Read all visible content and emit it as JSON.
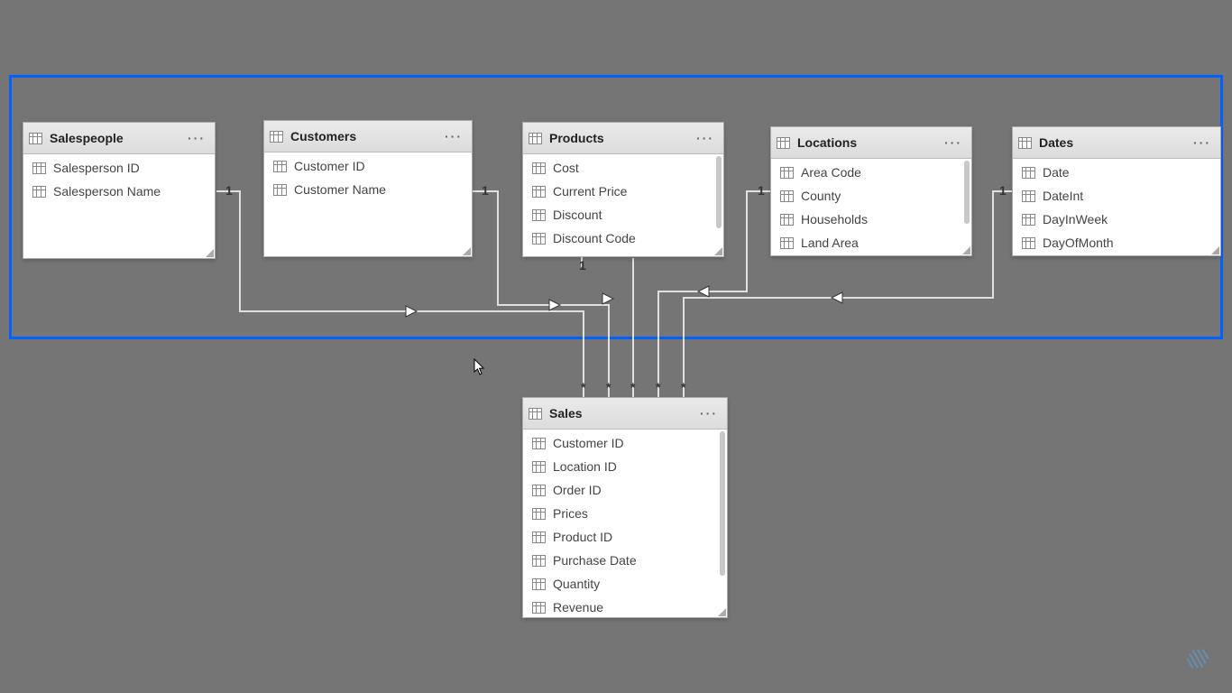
{
  "selection": true,
  "tables": {
    "salespeople": {
      "title": "Salespeople",
      "fields": [
        "Salesperson ID",
        "Salesperson Name"
      ]
    },
    "customers": {
      "title": "Customers",
      "fields": [
        "Customer ID",
        "Customer Name"
      ]
    },
    "products": {
      "title": "Products",
      "fields": [
        "Cost",
        "Current Price",
        "Discount",
        "Discount Code"
      ],
      "scroll": true
    },
    "locations": {
      "title": "Locations",
      "fields": [
        "Area Code",
        "County",
        "Households",
        "Land Area"
      ],
      "scroll": true
    },
    "dates": {
      "title": "Dates",
      "fields": [
        "Date",
        "DateInt",
        "DayInWeek",
        "DayOfMonth"
      ]
    },
    "sales": {
      "title": "Sales",
      "fields": [
        "Customer ID",
        "Location ID",
        "Order ID",
        "Prices",
        "Product ID",
        "Purchase Date",
        "Quantity",
        "Revenue"
      ],
      "scroll": true
    }
  },
  "relationships": [
    {
      "from": "salespeople",
      "to": "sales",
      "from_card": "1",
      "to_card": "*"
    },
    {
      "from": "customers",
      "to": "sales",
      "from_card": "1",
      "to_card": "*"
    },
    {
      "from": "products",
      "to": "sales",
      "from_card": "1",
      "to_card": "*"
    },
    {
      "from": "locations",
      "to": "sales",
      "from_card": "1",
      "to_card": "*"
    },
    {
      "from": "dates",
      "to": "sales",
      "from_card": "1",
      "to_card": "*"
    }
  ],
  "cardinality": {
    "one": "1",
    "many": "*"
  }
}
